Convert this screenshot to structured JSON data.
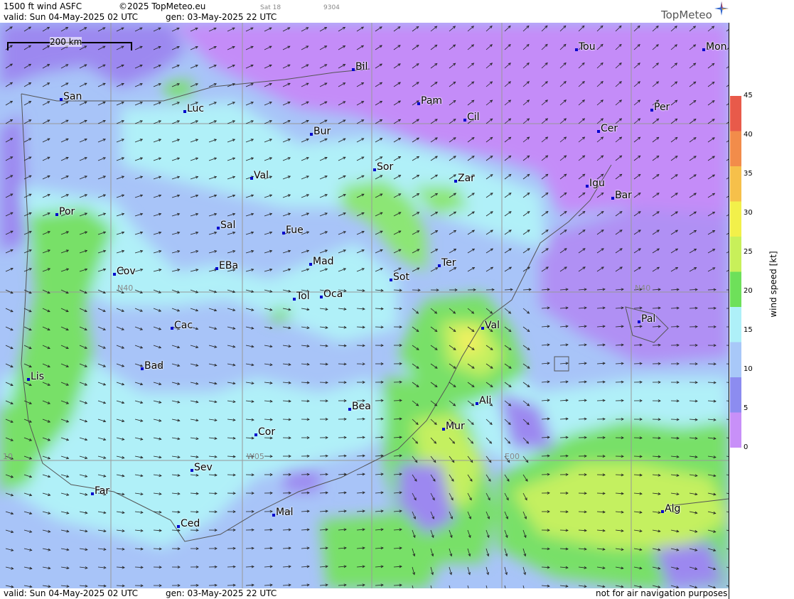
{
  "header": {
    "product": "1500 ft wind ASFC",
    "copyright": "©2025 TopMeteo.eu",
    "valid": "valid:  Sun  04-May-2025  02 UTC",
    "generated": "gen: 03-May-2025 22 UTC",
    "small_code1": "Sat 18",
    "small_code2": "9304",
    "logo": "TopMeteo",
    "logo_icon": "compass-star-icon"
  },
  "footer": {
    "valid": "valid:  Sun  04-May-2025  02 UTC",
    "generated": "gen: 03-May-2025 22 UTC",
    "disclaimer": "not for air navigation purposes"
  },
  "map": {
    "scalebar_label": "200 km",
    "grid_labels": {
      "n40_west": "N40",
      "n40_east": "N40",
      "w05": "W05",
      "e00": "E00",
      "w10": "10"
    },
    "cities": [
      {
        "name": "Bil"
      },
      {
        "name": "Tou"
      },
      {
        "name": "Mon"
      },
      {
        "name": "San"
      },
      {
        "name": "Luc"
      },
      {
        "name": "Pam"
      },
      {
        "name": "Cil"
      },
      {
        "name": "Per"
      },
      {
        "name": "Bur"
      },
      {
        "name": "Cer"
      },
      {
        "name": "Sor"
      },
      {
        "name": "Val"
      },
      {
        "name": "Zar"
      },
      {
        "name": "Igu"
      },
      {
        "name": "Bar"
      },
      {
        "name": "Por"
      },
      {
        "name": "Sal"
      },
      {
        "name": "Fue"
      },
      {
        "name": "Mad"
      },
      {
        "name": "Cov"
      },
      {
        "name": "EBa"
      },
      {
        "name": "Ter"
      },
      {
        "name": "Sot"
      },
      {
        "name": "Tol"
      },
      {
        "name": "Oca"
      },
      {
        "name": "Pal"
      },
      {
        "name": "Cac"
      },
      {
        "name": "Val"
      },
      {
        "name": "Bad"
      },
      {
        "name": "Lis"
      },
      {
        "name": "Ali"
      },
      {
        "name": "Bea"
      },
      {
        "name": "Mur"
      },
      {
        "name": "Cor"
      },
      {
        "name": "Sev"
      },
      {
        "name": "Far"
      },
      {
        "name": "Alg"
      },
      {
        "name": "Mal"
      },
      {
        "name": "Ced"
      }
    ]
  },
  "legend": {
    "title": "wind speed  [kt]",
    "ticks": [
      "45",
      "40",
      "35",
      "30",
      "25",
      "20",
      "15",
      "10",
      "5",
      "0"
    ],
    "colors": [
      "#e85a4a",
      "#f28c4a",
      "#f6c04a",
      "#f2f04a",
      "#c8f05a",
      "#6ee05a",
      "#aef0f8",
      "#a8c8f8",
      "#8c8cf0",
      "#c890f8"
    ]
  },
  "palette": {
    "purple": "#c48cf8",
    "violet": "#9c88f0",
    "blue": "#a8c4f8",
    "cyan": "#b0f0f8",
    "green": "#78e068",
    "lime": "#c4f060",
    "yellow": "#f0f060"
  }
}
